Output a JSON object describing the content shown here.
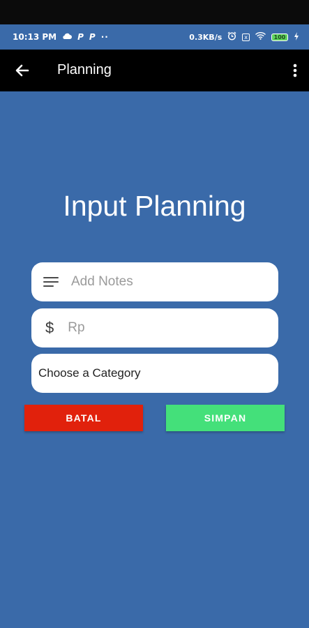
{
  "status_bar": {
    "time": "10:13 PM",
    "left_icons": [
      "cloud-icon",
      "p-icon",
      "p-icon",
      "more-dots-icon"
    ],
    "p1": "P",
    "p2": "P",
    "dots": "··",
    "network_speed": "0.3KB/s",
    "sim_box": "x",
    "battery": "100",
    "right_icons": [
      "alarm-icon",
      "sim-icon",
      "wifi-icon",
      "battery-icon",
      "charging-icon"
    ]
  },
  "app_bar": {
    "title": "Planning",
    "back_icon": "arrow-back-icon",
    "menu_icon": "more-vert-icon"
  },
  "form": {
    "heading": "Input Planning",
    "notes_placeholder": "Add Notes",
    "notes_icon": "notes-lines-icon",
    "amount_symbol": "$",
    "amount_placeholder": "Rp",
    "category_label": "Choose a Category",
    "cancel_label": "BATAL",
    "save_label": "SIMPAN"
  },
  "colors": {
    "background": "#3a6aa9",
    "app_bar": "#000000",
    "cancel_button": "#e1210c",
    "save_button": "#44e07a"
  }
}
